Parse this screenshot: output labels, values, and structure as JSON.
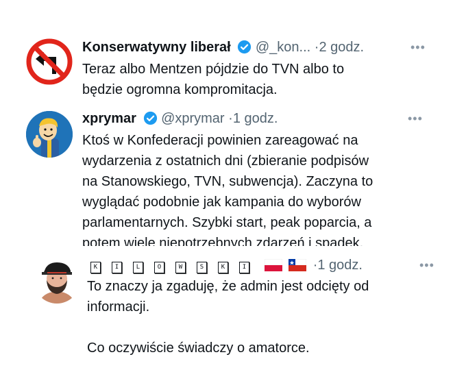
{
  "tweets": [
    {
      "name": "Konserwatywny liberał",
      "handle": "@_kon...",
      "separator": "·",
      "time": "2 godz.",
      "more": "•••",
      "avatar_icon": "no-left-turn-sign",
      "lines": [
        "Teraz albo Mentzen pójdzie do TVN albo to",
        "będzie ogromna kompromitacja."
      ]
    },
    {
      "name": "xprymar",
      "handle": "@xprymar",
      "separator": "·",
      "time": "1 godz.",
      "more": "•••",
      "avatar_icon": "vault-boy-avatar",
      "lines": [
        "Ktoś w Konfederacji powinien zareagować na",
        "wydarzenia z ostatnich dni (zbieranie podpisów",
        "na Stanowskiego, TVN, subwencja). Zaczyna to",
        "wyglądać podobnie jak kampania do wyborów",
        "parlamentarnych. Szybki start, peak poparcia, a",
        "potem wiele niepotrzebnych zdarzeń i spadek."
      ]
    },
    {
      "name_letters": [
        "K",
        "I",
        "L",
        "O",
        "W",
        "S",
        "K",
        "I"
      ],
      "flags": [
        "flag-poland",
        "flag-chile"
      ],
      "separator": "·",
      "time": "1 godz.",
      "more": "•••",
      "avatar_icon": "bearded-man-cap-avatar",
      "lines": [
        "To znaczy ja zgaduję, że admin jest odcięty od",
        "informacji.",
        "",
        "Co oczywiście świadczy o amatorce."
      ]
    }
  ],
  "colors": {
    "verified": "#1d9bf0",
    "text": "#0f1419",
    "meta": "#536471"
  }
}
